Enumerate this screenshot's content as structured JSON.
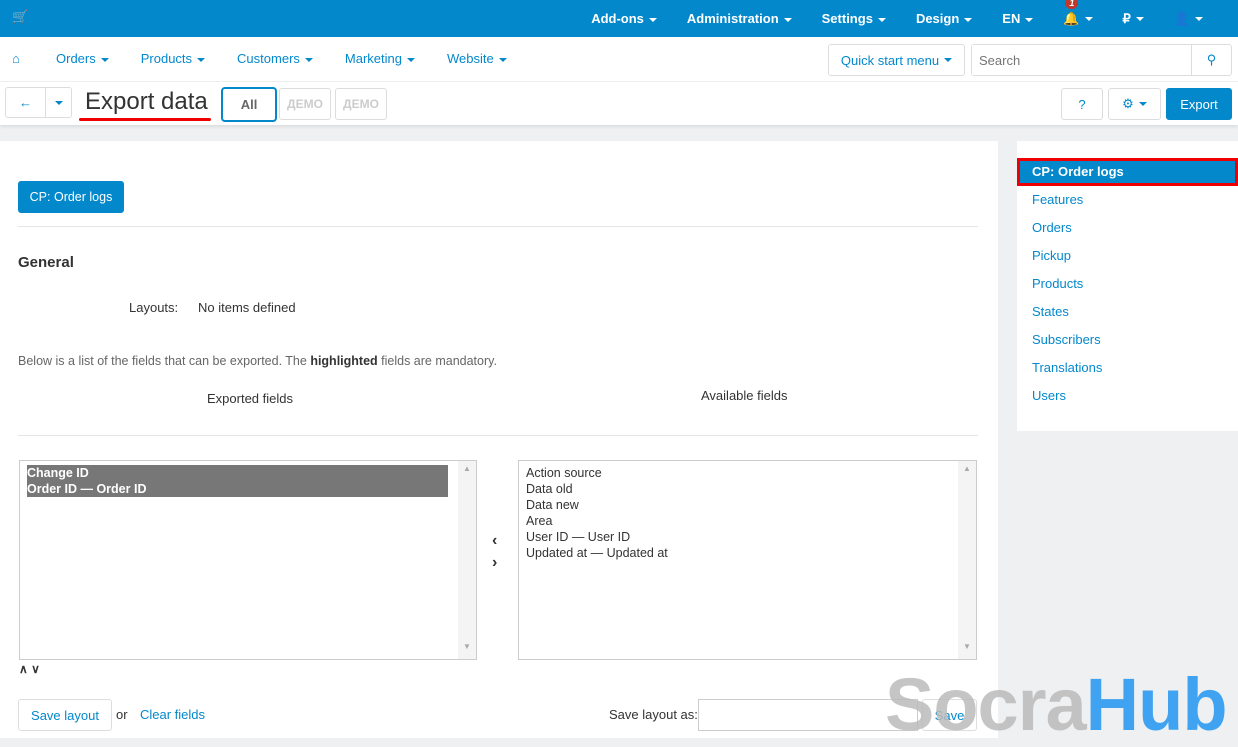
{
  "topbar": {
    "items": [
      "Add-ons",
      "Administration",
      "Settings",
      "Design",
      "EN"
    ],
    "notifications": "1",
    "currency": "₽"
  },
  "nav": {
    "items": [
      "Orders",
      "Products",
      "Customers",
      "Marketing",
      "Website"
    ],
    "quick_start": "Quick start menu",
    "search_placeholder": "Search"
  },
  "toolbar": {
    "title": "Export data",
    "filter_all": "All",
    "demo1": "ДЕМО",
    "demo2": "ДЕМО",
    "export": "Export"
  },
  "main": {
    "preset_button": "CP: Order logs",
    "section": "General",
    "layouts_label": "Layouts:",
    "layouts_value": "No items defined",
    "note_pre": "Below is a list of the fields that can be exported. The ",
    "note_bold": "highlighted",
    "note_post": " fields are mandatory.",
    "exported_label": "Exported fields",
    "available_label": "Available fields",
    "exported_fields": [
      "Change ID",
      "Order ID — Order ID"
    ],
    "available_fields": [
      "Action source",
      "Data old",
      "Data new",
      "Area",
      "User ID — User ID",
      "Updated at — Updated at"
    ],
    "save_layout": "Save layout",
    "or": "or",
    "clear_fields": "Clear fields",
    "save_layout_as": "Save layout as:",
    "save": "Save"
  },
  "sidebar": {
    "items": [
      "CP: Order logs",
      "Features",
      "Orders",
      "Pickup",
      "Products",
      "States",
      "Subscribers",
      "Translations",
      "Users"
    ]
  },
  "watermark": {
    "part1": "Socra",
    "part2": "Hub"
  }
}
